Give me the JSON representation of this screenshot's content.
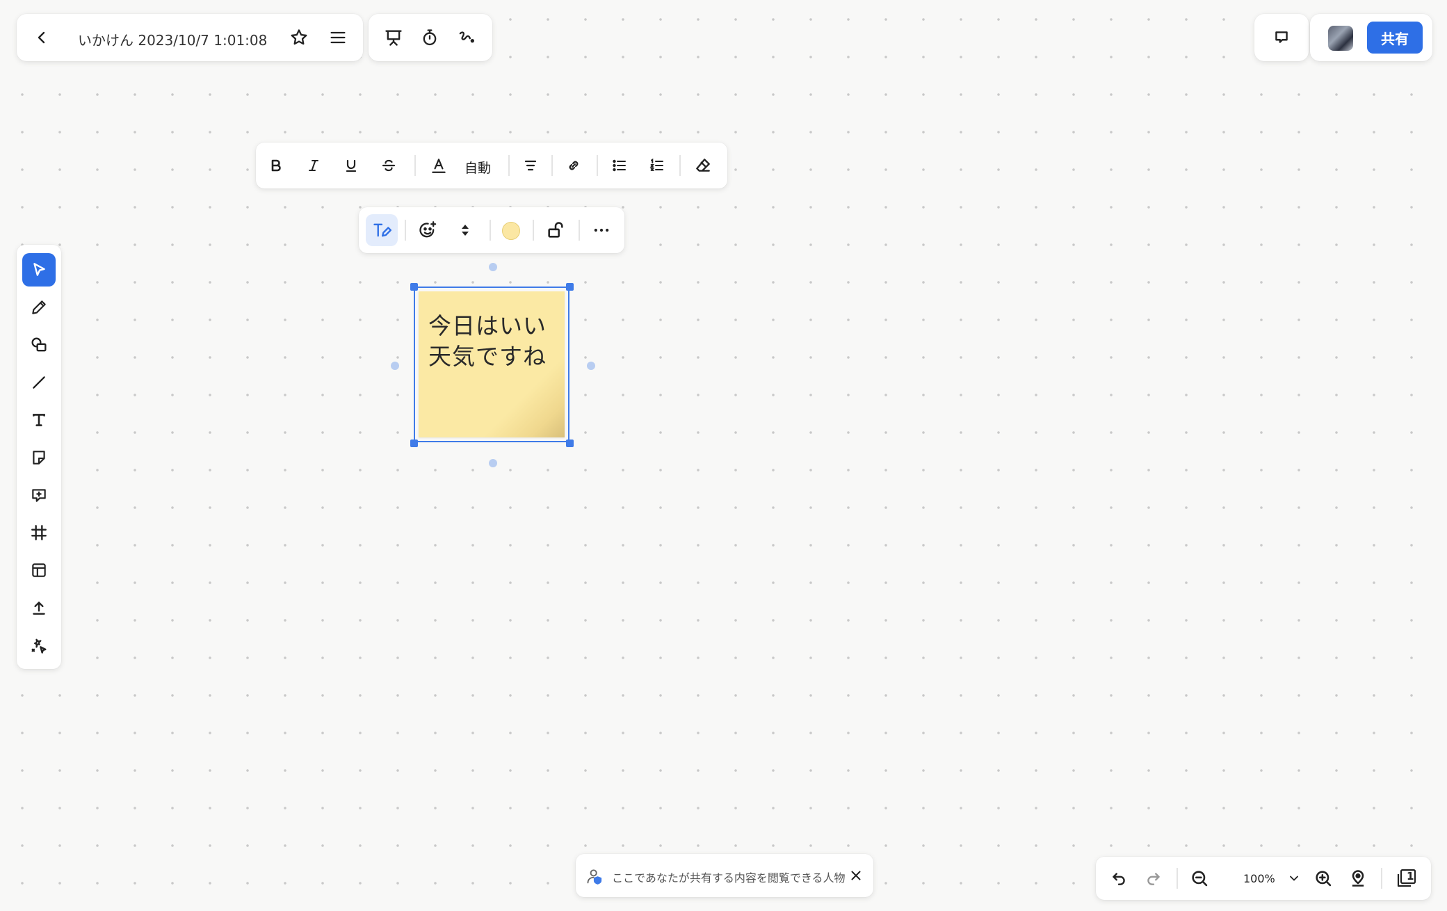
{
  "header": {
    "doc_title": "いかけん 2023/10/7 1:01:08",
    "share_label": "共有"
  },
  "text_toolbar": {
    "font_size": "自動"
  },
  "sticky_note": {
    "text": "今日はいい天気ですね",
    "color": "#fbe9a4"
  },
  "accent_color": "#2e6fe6",
  "notice": {
    "text": "ここであなたが共有する内容を閲覧できる人物"
  },
  "zoom": {
    "level": "100%"
  },
  "pages": {
    "count": "1"
  }
}
